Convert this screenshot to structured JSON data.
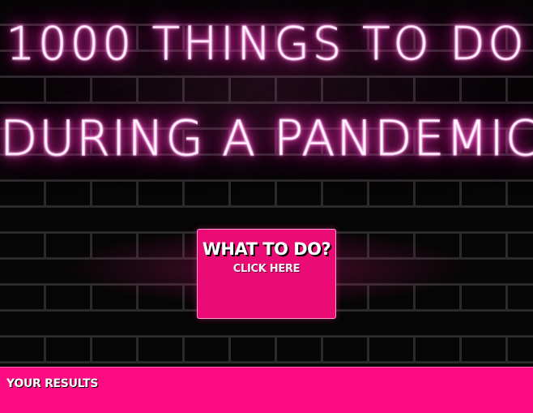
{
  "heading": {
    "line1": "1000 THINGS TO DO",
    "line2": "DURING A PANDEMIC"
  },
  "cta": {
    "title": "WHAT TO DO?",
    "subtitle": "CLICK HERE"
  },
  "results": {
    "label": "YOUR RESULTS"
  },
  "colors": {
    "neon_glow": "#ff36c0",
    "button_bg": "#ea0c74",
    "results_bar": "#fc0c82",
    "wall_bg": "#060606"
  }
}
